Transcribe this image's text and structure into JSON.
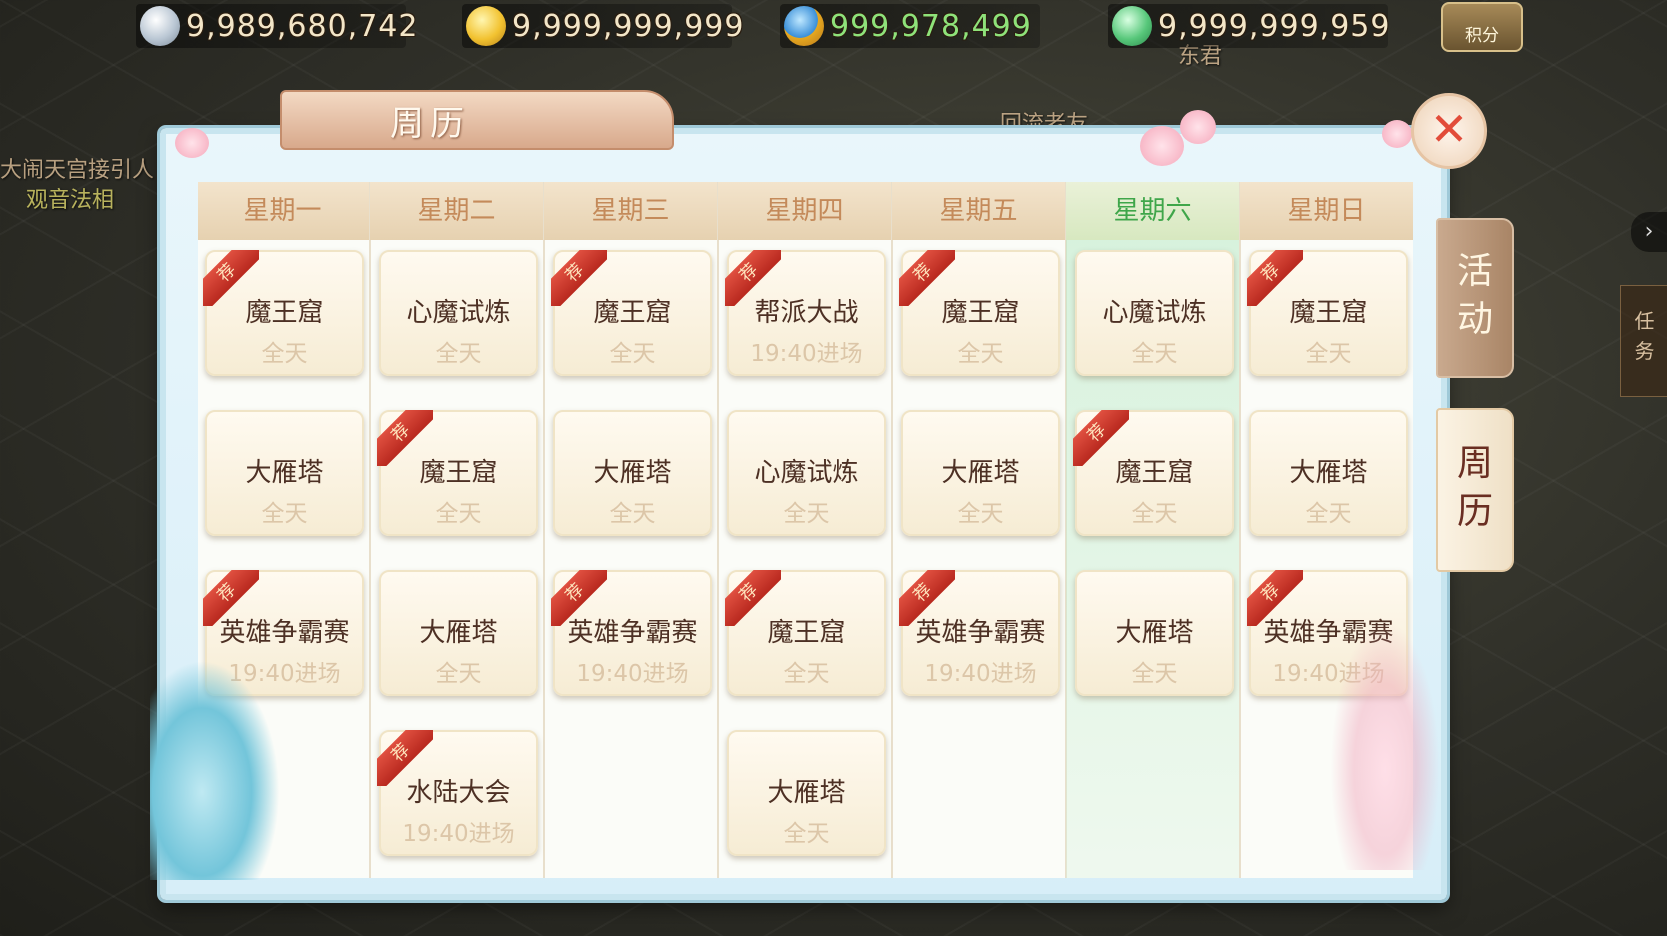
{
  "currencies": [
    {
      "icon": "silver-ingot-icon",
      "value": "9,989,680,742",
      "green": false
    },
    {
      "icon": "gold-ingot-icon",
      "value": "9,999,999,999",
      "green": false
    },
    {
      "icon": "coin-icon",
      "value": "999,978,499",
      "green": true
    },
    {
      "icon": "jade-icon",
      "value": "9,999,999,959",
      "green": false
    }
  ],
  "points_button": "积分",
  "background_labels": {
    "left_line1": "大闹天宫接引人",
    "left_line2": "观音法相",
    "center": "回流老友",
    "top_center": "东君"
  },
  "panel": {
    "title": "周历",
    "close": "✕",
    "side_tabs": [
      {
        "chars": [
          "活",
          "动"
        ],
        "active": false
      },
      {
        "chars": [
          "周",
          "历"
        ],
        "active": true
      }
    ],
    "today_index": 5,
    "days": [
      {
        "name": "星期一",
        "events": [
          {
            "name": "魔王窟",
            "time": "全天",
            "rec": true
          },
          {
            "name": "大雁塔",
            "time": "全天",
            "rec": false
          },
          {
            "name": "英雄争霸赛",
            "time": "19:40进场",
            "rec": true
          }
        ]
      },
      {
        "name": "星期二",
        "events": [
          {
            "name": "心魔试炼",
            "time": "全天",
            "rec": false
          },
          {
            "name": "魔王窟",
            "time": "全天",
            "rec": true
          },
          {
            "name": "大雁塔",
            "time": "全天",
            "rec": false
          },
          {
            "name": "水陆大会",
            "time": "19:40进场",
            "rec": true
          }
        ]
      },
      {
        "name": "星期三",
        "events": [
          {
            "name": "魔王窟",
            "time": "全天",
            "rec": true
          },
          {
            "name": "大雁塔",
            "time": "全天",
            "rec": false
          },
          {
            "name": "英雄争霸赛",
            "time": "19:40进场",
            "rec": true
          }
        ]
      },
      {
        "name": "星期四",
        "events": [
          {
            "name": "帮派大战",
            "time": "19:40进场",
            "rec": true
          },
          {
            "name": "心魔试炼",
            "time": "全天",
            "rec": false
          },
          {
            "name": "魔王窟",
            "time": "全天",
            "rec": true
          },
          {
            "name": "大雁塔",
            "time": "全天",
            "rec": false
          }
        ]
      },
      {
        "name": "星期五",
        "events": [
          {
            "name": "魔王窟",
            "time": "全天",
            "rec": true
          },
          {
            "name": "大雁塔",
            "time": "全天",
            "rec": false
          },
          {
            "name": "英雄争霸赛",
            "time": "19:40进场",
            "rec": true
          }
        ]
      },
      {
        "name": "星期六",
        "events": [
          {
            "name": "心魔试炼",
            "time": "全天",
            "rec": false
          },
          {
            "name": "魔王窟",
            "time": "全天",
            "rec": true
          },
          {
            "name": "大雁塔",
            "time": "全天",
            "rec": false
          }
        ]
      },
      {
        "name": "星期日",
        "events": [
          {
            "name": "魔王窟",
            "time": "全天",
            "rec": true
          },
          {
            "name": "大雁塔",
            "time": "全天",
            "rec": false
          },
          {
            "name": "英雄争霸赛",
            "time": "19:40进场",
            "rec": true
          }
        ]
      }
    ],
    "rec_label": "荐"
  },
  "right_edge": {
    "arrow": "›",
    "task_chars": [
      "任",
      "务"
    ]
  },
  "colors": {
    "today_header": "#3fa64a",
    "day_header": "#c48a5a",
    "rec_ribbon": "#d23a2e",
    "close_x": "#e24c3a"
  }
}
